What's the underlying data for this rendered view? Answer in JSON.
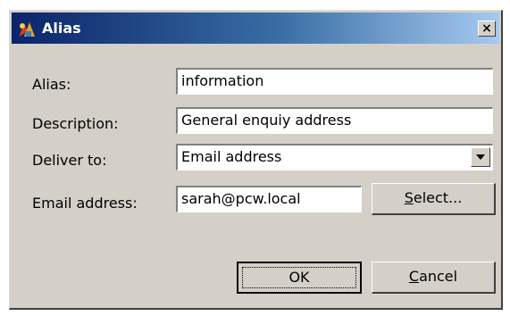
{
  "window": {
    "title": "Alias",
    "close_glyph": "×"
  },
  "icons": {
    "app": "alias-app-icon",
    "close": "close-icon",
    "dropdown": "chevron-down-icon"
  },
  "form": {
    "alias_label": "Alias:",
    "alias_value": "information",
    "description_label": "Description:",
    "description_value": "General enquiy address",
    "deliver_label": "Deliver to:",
    "deliver_value": "Email address",
    "email_label": "Email address:",
    "email_value": "sarah@pcw.local"
  },
  "buttons": {
    "select_accel": "S",
    "select_rest": "elect...",
    "ok": "OK",
    "cancel_accel": "C",
    "cancel_rest": "ancel"
  },
  "colors": {
    "dialog_bg": "#d4d0c8",
    "titlebar_start": "#0a246a",
    "titlebar_end": "#a6caf0"
  }
}
